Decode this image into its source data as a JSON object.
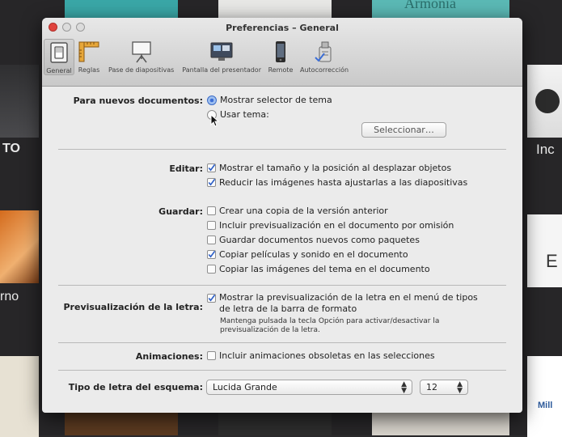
{
  "background": {
    "tile_texts": [
      "Armonia",
      "TO",
      "Inc",
      "E",
      "rno",
      "Mill"
    ]
  },
  "window": {
    "title": "Preferencias – General",
    "toolbar": [
      {
        "label": "General",
        "icon": "switch-icon"
      },
      {
        "label": "Reglas",
        "icon": "ruler-icon"
      },
      {
        "label": "Pase de diapositivas",
        "icon": "easel-icon"
      },
      {
        "label": "Pantalla del presentador",
        "icon": "display-icon"
      },
      {
        "label": "Remote",
        "icon": "iphone-icon"
      },
      {
        "label": "Autocorrección",
        "icon": "spellcheck-icon"
      }
    ],
    "selected_tab": "General"
  },
  "new_docs": {
    "label": "Para nuevos documentos:",
    "opt_selector": "Mostrar selector de tema",
    "opt_theme": "Usar tema:",
    "select_button": "Seleccionar…",
    "selected": "Mostrar selector de tema"
  },
  "edit": {
    "label": "Editar:",
    "options": [
      {
        "text": "Mostrar el tamaño y la posición al desplazar objetos",
        "checked": true
      },
      {
        "text": "Reducir las imágenes hasta ajustarlas a las diapositivas",
        "checked": true
      }
    ]
  },
  "save": {
    "label": "Guardar:",
    "options": [
      {
        "text": "Crear una copia de la versión anterior",
        "checked": false
      },
      {
        "text": "Incluir previsualización en el documento por omisión",
        "checked": false
      },
      {
        "text": "Guardar documentos nuevos como paquetes",
        "checked": false
      },
      {
        "text": "Copiar películas y sonido en el documento",
        "checked": true
      },
      {
        "text": "Copiar las imágenes del tema en el documento",
        "checked": false
      }
    ]
  },
  "font_preview": {
    "label": "Previsualización de la letra:",
    "option_line1": "Mostrar la previsualización de la letra en el menú de tipos",
    "option_line2": "de letra de la barra de formato",
    "checked": true,
    "note_line1": "Mantenga pulsada la tecla Opción para activar/desactivar la",
    "note_line2": "previsualización de la letra."
  },
  "animations": {
    "label": "Animaciones:",
    "option": "Incluir animaciones obsoletas en las selecciones",
    "checked": false
  },
  "outline_font": {
    "label": "Tipo de letra del esquema:",
    "font": "Lucida Grande",
    "size": "12"
  },
  "colors": {
    "accent": "#3d6fd6",
    "checkmark": "#2d5fc7"
  }
}
